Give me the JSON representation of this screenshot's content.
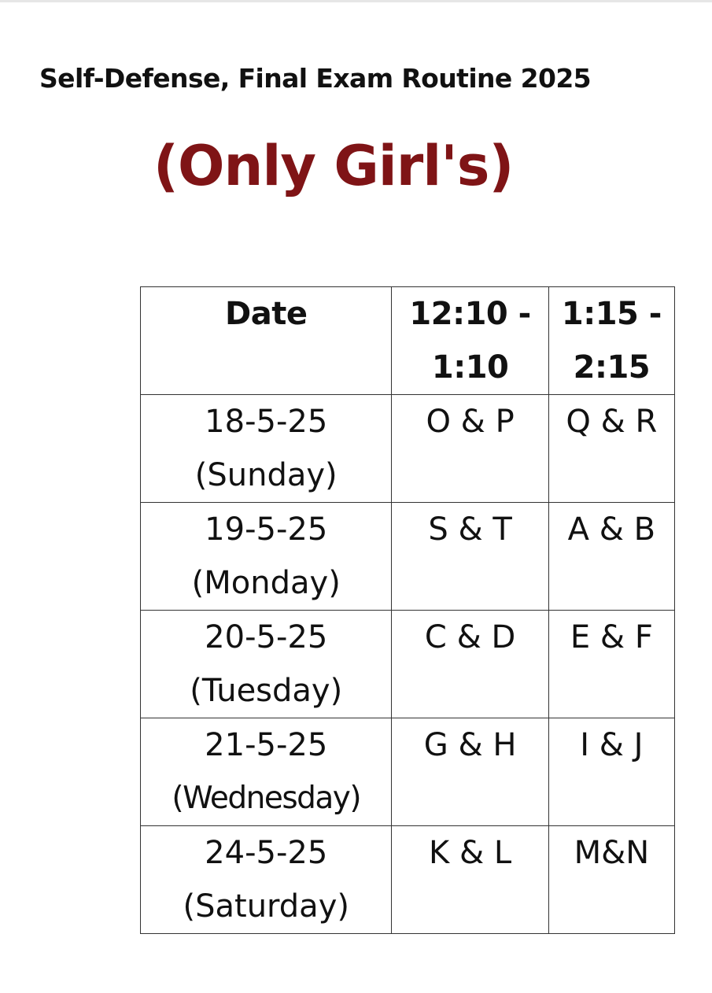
{
  "title": "Self-Defense, Final Exam Routine 2025",
  "subtitle": "(Only Girl's)",
  "colors": {
    "subtitle": "#7f1416",
    "text": "#111111",
    "border": "#333333"
  },
  "table": {
    "headers": {
      "date": "Date",
      "slot1_line1": "12:10 -",
      "slot1_line2": "1:10",
      "slot2_line1": "1:15 -",
      "slot2_line2": "2:15"
    },
    "rows": [
      {
        "date": "18-5-25",
        "day": "(Sunday)",
        "slot1": "O & P",
        "slot2": "Q & R"
      },
      {
        "date": "19-5-25",
        "day": "(Monday)",
        "slot1": "S & T",
        "slot2": "A & B"
      },
      {
        "date": "20-5-25",
        "day": "(Tuesday)",
        "slot1": "C & D",
        "slot2": "E & F"
      },
      {
        "date": "21-5-25",
        "day": "(Wednesday)",
        "slot1": "G & H",
        "slot2": "I & J"
      },
      {
        "date": "24-5-25",
        "day": "(Saturday)",
        "slot1": "K & L",
        "slot2": "M&N"
      }
    ]
  }
}
